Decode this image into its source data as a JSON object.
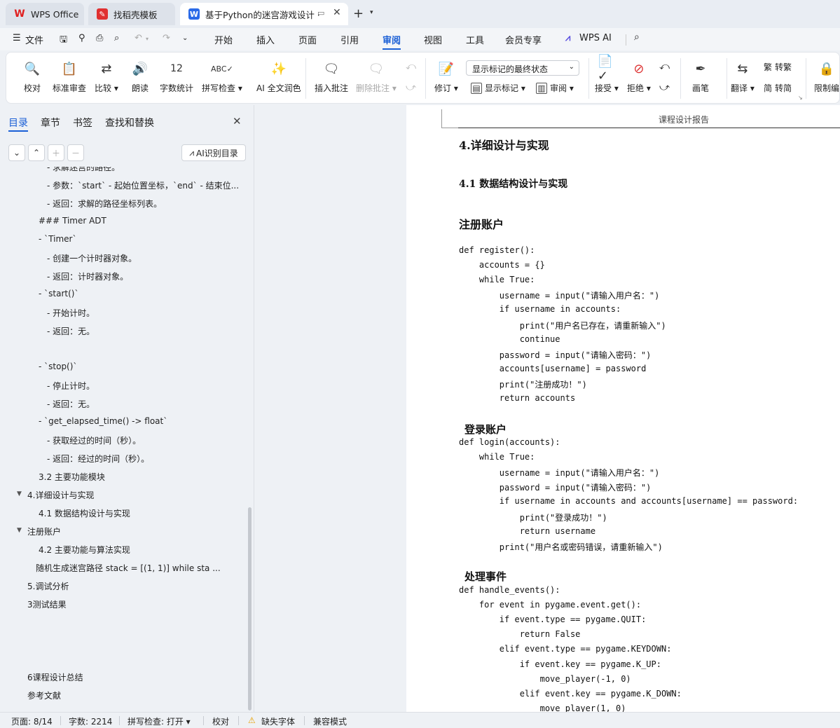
{
  "tabs": [
    {
      "label": "WPS Office",
      "icon": "wps-logo-icon",
      "color": "#e02020"
    },
    {
      "label": "找稻壳模板",
      "icon": "docer-icon",
      "color": "#e03030"
    },
    {
      "label": "基于Python的迷宫游戏设计 ·",
      "icon": "word-doc-icon",
      "color": "#2a6ae8"
    }
  ],
  "menu": {
    "file": "文件",
    "items": [
      "开始",
      "插入",
      "页面",
      "引用",
      "审阅",
      "视图",
      "工具",
      "会员专享"
    ],
    "active": "审阅",
    "ai": "WPS AI"
  },
  "ribbon": {
    "proofread": "校对",
    "std_review": "标准审查",
    "compare": "比较",
    "read_aloud": "朗读",
    "word_count": "字数统计",
    "spell_check": "拼写检查",
    "ai_polish": "AI 全文润色",
    "insert_comment": "插入批注",
    "delete_comment": "删除批注",
    "markup_select": "显示标记的最终状态",
    "track": "修订",
    "show_markup": "显示标记",
    "review": "审阅",
    "accept": "接受",
    "reject": "拒绝",
    "pen": "画笔",
    "translate": "翻译",
    "to_trad": "转繁",
    "to_simp": "转简",
    "restrict": "限制编"
  },
  "nav": {
    "tabs": [
      "目录",
      "章节",
      "书签",
      "查找和替换"
    ],
    "ai_toc": "AI识别目录",
    "items": [
      {
        "text": "- 求解迷宫的路径。"
      },
      {
        "text": "- 参数：`start` - 起始位置坐标，`end` - 结束位..."
      },
      {
        "text": "- 返回：求解的路径坐标列表。"
      },
      {
        "text": "### Timer ADT"
      },
      {
        "text": "- `Timer`"
      },
      {
        "text": "- 创建一个计时器对象。"
      },
      {
        "text": "- 返回：计时器对象。"
      },
      {
        "text": "- `start()`"
      },
      {
        "text": "- 开始计时。"
      },
      {
        "text": "- 返回：无。"
      },
      {
        "text": "- `stop()`"
      },
      {
        "text": "- 停止计时。"
      },
      {
        "text": "- 返回：无。"
      },
      {
        "text": "- `get_elapsed_time() -> float`"
      },
      {
        "text": "- 获取经过的时间（秒）。"
      },
      {
        "text": "- 返回：经过的时间（秒）。"
      },
      {
        "text": "3.2  主要功能模块"
      },
      {
        "text": "4.详细设计与实现"
      },
      {
        "text": "4.1  数据结构设计与实现"
      },
      {
        "text": "注册账户"
      },
      {
        "text": "4.2  主要功能与算法实现"
      },
      {
        "text": "随机生成迷宫路径       stack = [(1, 1)]       while sta ..."
      },
      {
        "text": "5.调试分析"
      },
      {
        "text": "3测试结果"
      },
      {
        "text": "6课程设计总结"
      },
      {
        "text": "参考文献"
      }
    ]
  },
  "doc": {
    "header": "课程设计报告",
    "h1": "4.详细设计与实现",
    "h2": "4.1  数据结构设计与实现",
    "s1": "注册账户",
    "code1": [
      "def register():",
      "    accounts = {}",
      "    while True:",
      "        username = input(\"请输入用户名：\")",
      "        if username in accounts:",
      "            print(\"用户名已存在，请重新输入\")",
      "            continue",
      "        password = input(\"请输入密码：\")",
      "        accounts[username] = password",
      "        print(\"注册成功！\")",
      "        return accounts"
    ],
    "s2": "登录账户",
    "code2": [
      "def login(accounts):",
      "    while True:",
      "        username = input(\"请输入用户名：\")",
      "        password = input(\"请输入密码：\")",
      "        if username in accounts and accounts[username] == password:",
      "            print(\"登录成功！\")",
      "            return username",
      "        print(\"用户名或密码错误，请重新输入\")"
    ],
    "s3": "处理事件",
    "code3": [
      "def handle_events():",
      "    for event in pygame.event.get():",
      "        if event.type == pygame.QUIT:",
      "            return False",
      "        elif event.type == pygame.KEYDOWN:",
      "            if event.key == pygame.K_UP:",
      "                move_player(-1, 0)",
      "            elif event.key == pygame.K_DOWN:",
      "                move_player(1, 0)"
    ]
  },
  "status": {
    "page": "页面: 8/14",
    "words": "字数: 2214",
    "spell": "拼写检查: 打开",
    "proof": "校对",
    "font": "缺失字体",
    "compat": "兼容模式"
  }
}
